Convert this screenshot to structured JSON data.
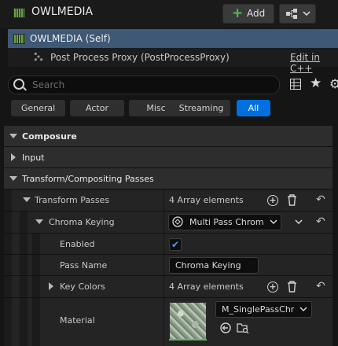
{
  "header": {
    "title": "OWLMEDIA",
    "add_label": "Add",
    "add_icon": "plus-icon",
    "blueprint_icon": "blueprint-icon"
  },
  "tree": {
    "self_label": "OWLMEDIA (Self)",
    "component_label": "Post Process Proxy (PostProcessProxy)",
    "edit_link": "Edit in C++"
  },
  "search": {
    "placeholder": "Search"
  },
  "filters": [
    {
      "label": "General",
      "active": false
    },
    {
      "label": "Actor",
      "active": false
    },
    {
      "label": "Misc",
      "active": false
    },
    {
      "label": "Streaming",
      "active": false
    },
    {
      "label": "All",
      "active": true
    }
  ],
  "details": {
    "composure": "Composure",
    "input": "Input",
    "transform_compositing": "Transform/Compositing Passes",
    "transform_passes": {
      "label": "Transform Passes",
      "value": "4 Array elements"
    },
    "chroma_keying": {
      "label": "Chroma Keying",
      "value": "Multi Pass Chrom"
    },
    "enabled": {
      "label": "Enabled",
      "checked": true
    },
    "pass_name": {
      "label": "Pass Name",
      "value": "Chroma Keying"
    },
    "key_colors": {
      "label": "Key Colors",
      "value": "4 Array elements"
    },
    "material": {
      "label": "Material",
      "value": "M_SinglePassChr"
    }
  },
  "colors": {
    "accent": "#0070e0",
    "selection": "#3e5876",
    "add_plus": "#4fc04f",
    "checkmark": "#4a9cff"
  }
}
